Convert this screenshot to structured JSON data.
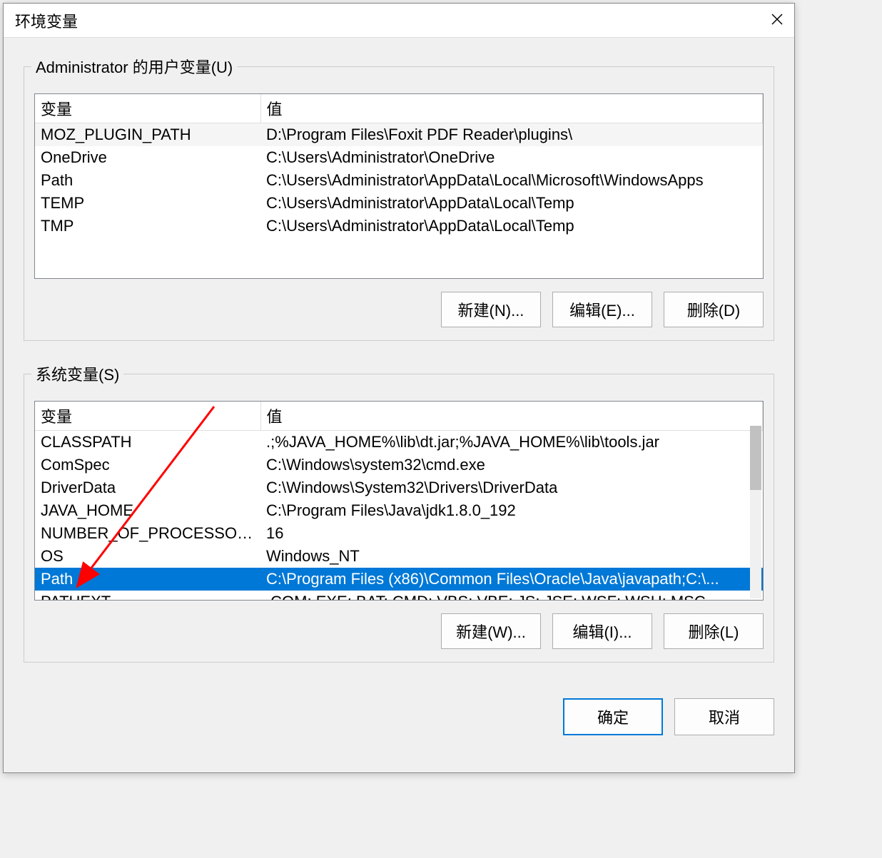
{
  "dialog": {
    "title": "环境变量",
    "ok_label": "确定",
    "cancel_label": "取消"
  },
  "columns": {
    "name": "变量",
    "value": "值"
  },
  "user_section": {
    "legend": "Administrator 的用户变量(U)",
    "new_label": "新建(N)...",
    "edit_label": "编辑(E)...",
    "delete_label": "删除(D)",
    "vars": [
      {
        "name": "MOZ_PLUGIN_PATH",
        "value": "D:\\Program Files\\Foxit PDF Reader\\plugins\\",
        "alt": true
      },
      {
        "name": "OneDrive",
        "value": "C:\\Users\\Administrator\\OneDrive"
      },
      {
        "name": "Path",
        "value": "C:\\Users\\Administrator\\AppData\\Local\\Microsoft\\WindowsApps"
      },
      {
        "name": "TEMP",
        "value": "C:\\Users\\Administrator\\AppData\\Local\\Temp"
      },
      {
        "name": "TMP",
        "value": "C:\\Users\\Administrator\\AppData\\Local\\Temp"
      }
    ]
  },
  "system_section": {
    "legend": "系统变量(S)",
    "new_label": "新建(W)...",
    "edit_label": "编辑(I)...",
    "delete_label": "删除(L)",
    "selected_index": 6,
    "vars": [
      {
        "name": "CLASSPATH",
        "value": ".;%JAVA_HOME%\\lib\\dt.jar;%JAVA_HOME%\\lib\\tools.jar"
      },
      {
        "name": "ComSpec",
        "value": "C:\\Windows\\system32\\cmd.exe"
      },
      {
        "name": "DriverData",
        "value": "C:\\Windows\\System32\\Drivers\\DriverData"
      },
      {
        "name": "JAVA_HOME",
        "value": "C:\\Program Files\\Java\\jdk1.8.0_192"
      },
      {
        "name": "NUMBER_OF_PROCESSORS",
        "value": "16"
      },
      {
        "name": "OS",
        "value": "Windows_NT"
      },
      {
        "name": "Path",
        "value": "C:\\Program Files (x86)\\Common Files\\Oracle\\Java\\javapath;C:\\..."
      },
      {
        "name": "PATHEXT",
        "value": ".COM;.EXE;.BAT;.CMD;.VBS;.VBE;.JS;.JSE;.WSF;.WSH;.MSC"
      }
    ]
  }
}
